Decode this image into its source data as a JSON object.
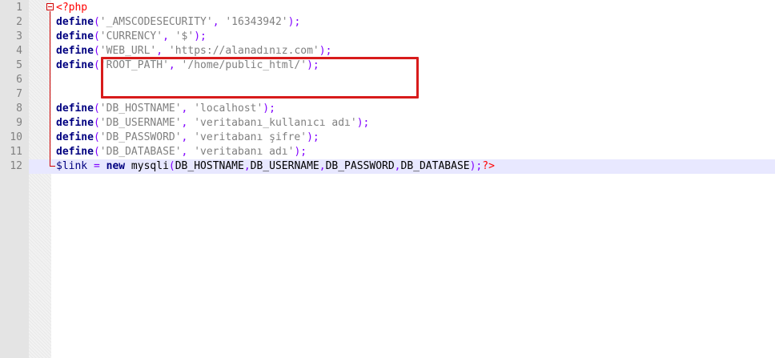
{
  "editor": {
    "language": "php",
    "current_line": 12,
    "lines": [
      {
        "number": "1",
        "tokens": [
          {
            "t": "<?php",
            "c": "php-tag"
          }
        ]
      },
      {
        "number": "2",
        "tokens": [
          {
            "t": "define",
            "c": "kw"
          },
          {
            "t": "(",
            "c": "op"
          },
          {
            "t": "'_AMSCODESECURITY'",
            "c": "str"
          },
          {
            "t": ", ",
            "c": "op"
          },
          {
            "t": "'16343942'",
            "c": "str"
          },
          {
            "t": ");",
            "c": "op"
          }
        ]
      },
      {
        "number": "3",
        "tokens": [
          {
            "t": "define",
            "c": "kw"
          },
          {
            "t": "(",
            "c": "op"
          },
          {
            "t": "'CURRENCY'",
            "c": "str"
          },
          {
            "t": ", ",
            "c": "op"
          },
          {
            "t": "'$'",
            "c": "str"
          },
          {
            "t": ");",
            "c": "op"
          }
        ]
      },
      {
        "number": "4",
        "tokens": [
          {
            "t": "define",
            "c": "kw"
          },
          {
            "t": "(",
            "c": "op"
          },
          {
            "t": "'WEB_URL'",
            "c": "str"
          },
          {
            "t": ", ",
            "c": "op"
          },
          {
            "t": "'https://alanadınız.com'",
            "c": "str"
          },
          {
            "t": ");",
            "c": "op"
          }
        ]
      },
      {
        "number": "5",
        "tokens": [
          {
            "t": "define",
            "c": "kw"
          },
          {
            "t": "(",
            "c": "op"
          },
          {
            "t": "'ROOT_PATH'",
            "c": "str"
          },
          {
            "t": ", ",
            "c": "op"
          },
          {
            "t": "'/home/public_html/'",
            "c": "str"
          },
          {
            "t": ");",
            "c": "op"
          }
        ]
      },
      {
        "number": "6",
        "tokens": []
      },
      {
        "number": "7",
        "tokens": []
      },
      {
        "number": "8",
        "tokens": [
          {
            "t": "define",
            "c": "kw"
          },
          {
            "t": "(",
            "c": "op"
          },
          {
            "t": "'DB_HOSTNAME'",
            "c": "str"
          },
          {
            "t": ", ",
            "c": "op"
          },
          {
            "t": "'localhost'",
            "c": "str"
          },
          {
            "t": ");",
            "c": "op"
          }
        ]
      },
      {
        "number": "9",
        "tokens": [
          {
            "t": "define",
            "c": "kw"
          },
          {
            "t": "(",
            "c": "op"
          },
          {
            "t": "'DB_USERNAME'",
            "c": "str"
          },
          {
            "t": ", ",
            "c": "op"
          },
          {
            "t": "'veritabanı_kullanıcı adı'",
            "c": "str"
          },
          {
            "t": ");",
            "c": "op"
          }
        ]
      },
      {
        "number": "10",
        "tokens": [
          {
            "t": "define",
            "c": "kw"
          },
          {
            "t": "(",
            "c": "op"
          },
          {
            "t": "'DB_PASSWORD'",
            "c": "str"
          },
          {
            "t": ", ",
            "c": "op"
          },
          {
            "t": "'veritabanı şifre'",
            "c": "str"
          },
          {
            "t": ");",
            "c": "op"
          }
        ]
      },
      {
        "number": "11",
        "tokens": [
          {
            "t": "define",
            "c": "kw"
          },
          {
            "t": "(",
            "c": "op"
          },
          {
            "t": "'DB_DATABASE'",
            "c": "str"
          },
          {
            "t": ", ",
            "c": "op"
          },
          {
            "t": "'veritabanı adı'",
            "c": "str"
          },
          {
            "t": ");",
            "c": "op"
          }
        ]
      },
      {
        "number": "12",
        "tokens": [
          {
            "t": "$link",
            "c": "var"
          },
          {
            "t": " = ",
            "c": "op"
          },
          {
            "t": "new",
            "c": "kw"
          },
          {
            "t": " mysqli",
            "c": "fn"
          },
          {
            "t": "(",
            "c": "op"
          },
          {
            "t": "DB_HOSTNAME",
            "c": "fn"
          },
          {
            "t": ",",
            "c": "op"
          },
          {
            "t": "DB_USERNAME",
            "c": "fn"
          },
          {
            "t": ",",
            "c": "op"
          },
          {
            "t": "DB_PASSWORD",
            "c": "fn"
          },
          {
            "t": ",",
            "c": "op"
          },
          {
            "t": "DB_DATABASE",
            "c": "fn"
          },
          {
            "t": ");",
            "c": "op"
          },
          {
            "t": "?>",
            "c": "php-tag"
          }
        ]
      }
    ]
  },
  "colors": {
    "highlight_box": "#d81b1b",
    "current_line_bg": "#e8e8ff",
    "keyword": "#000080",
    "string": "#808080",
    "php_tag": "#ff0000"
  },
  "annotation": {
    "highlighted_line": 5
  }
}
